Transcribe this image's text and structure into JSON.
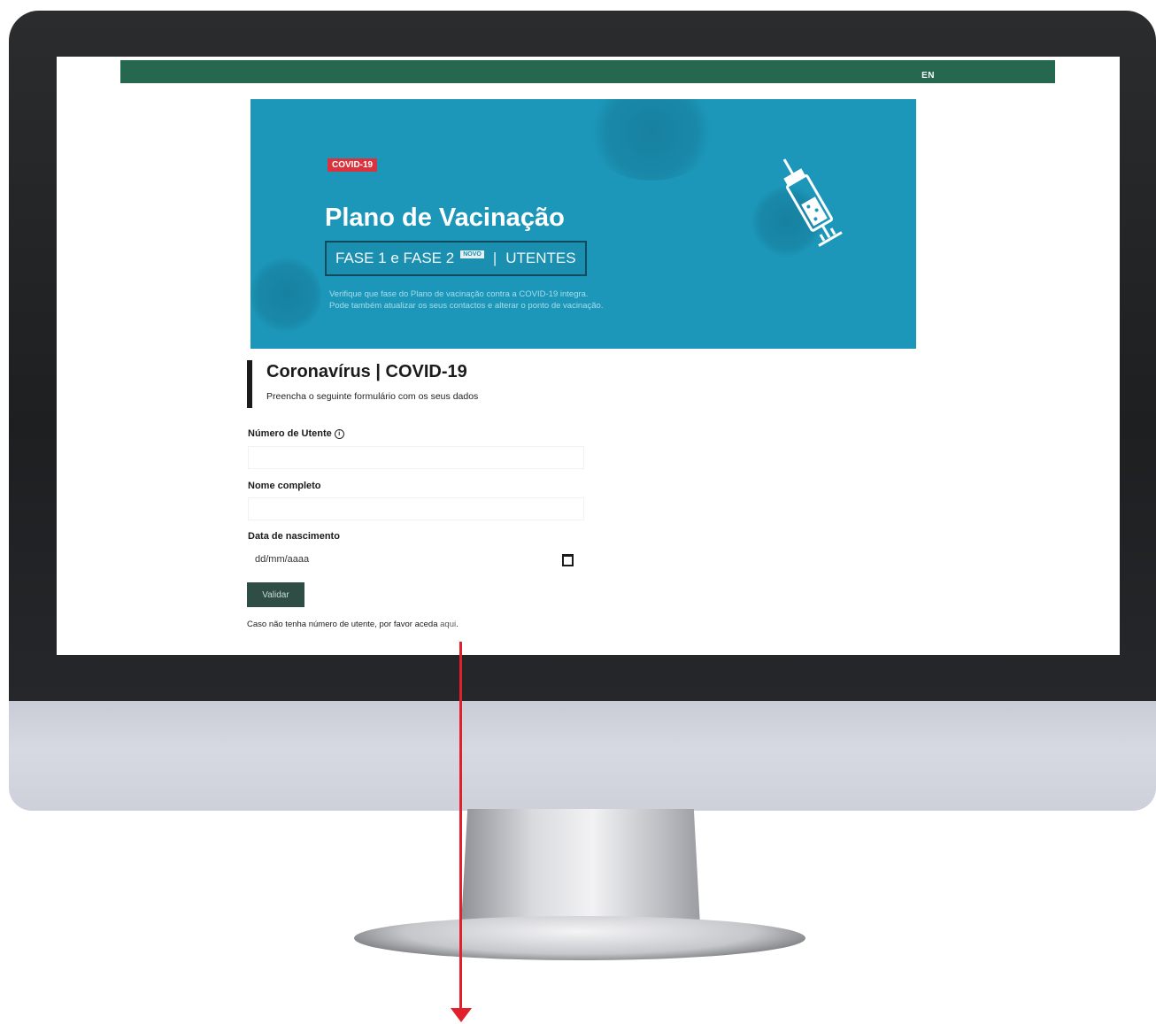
{
  "header": {
    "lang_link": "EN"
  },
  "banner": {
    "tag": "COVID-19",
    "title": "Plano de Vacinação",
    "phase_text": "FASE 1 e FASE 2",
    "phase_badge": "NOVO",
    "phase_separator": "|",
    "audience": "UTENTES",
    "description_line1": "Verifique que fase do Plano de vacinação contra a COVID-19 integra.",
    "description_line2": "Pode também atualizar os seus contactos e alterar o ponto de vacinação."
  },
  "section": {
    "title": "Coronavírus | COVID-19",
    "subtitle": "Preencha o seguinte formulário com os seus dados"
  },
  "form": {
    "utente_label": "Número de Utente",
    "utente_value": "",
    "name_label": "Nome completo",
    "name_value": "",
    "birthdate_label": "Data de nascimento",
    "birthdate_placeholder": "dd/mm/aaaa",
    "submit_label": "Validar"
  },
  "help": {
    "text": "Caso não tenha número de utente, por favor aceda ",
    "link": "aqui",
    "end": "."
  },
  "colors": {
    "topbar": "#25674f",
    "banner": "#1c97b9",
    "tag": "#d9343d",
    "button": "#2e4e45",
    "annotation_arrow": "#e0202a"
  }
}
